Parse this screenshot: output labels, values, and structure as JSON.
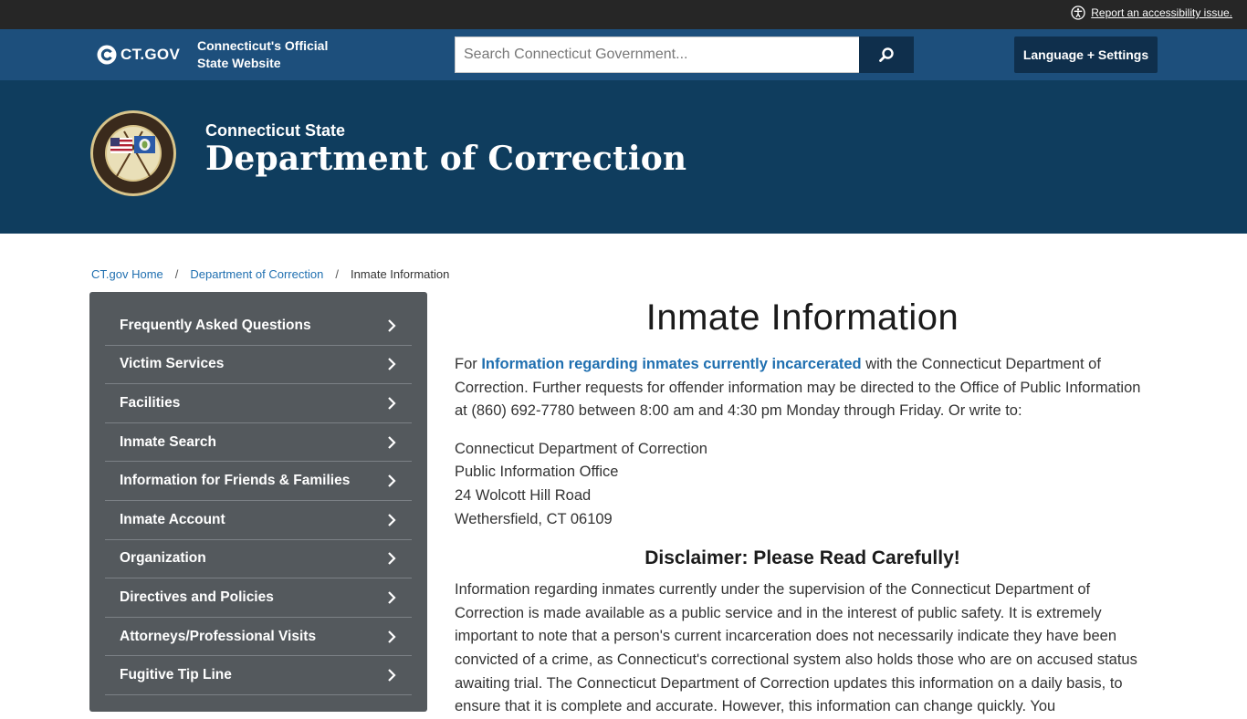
{
  "utility_bar": {
    "accessibility_link": "Report an accessibility issue."
  },
  "header": {
    "logo_text": "CT.GOV",
    "tagline": "Connecticut's Official State Website",
    "search_placeholder": "Search Connecticut Government...",
    "language_button": "Language + Settings"
  },
  "banner": {
    "subtitle": "Connecticut State",
    "title": "Department of Correction"
  },
  "breadcrumb": {
    "items": [
      "CT.gov Home",
      "Department of Correction",
      "Inmate Information"
    ]
  },
  "sidebar": {
    "items": [
      {
        "label": "Frequently Asked Questions"
      },
      {
        "label": "Victim Services"
      },
      {
        "label": "Facilities"
      },
      {
        "label": "Inmate Search"
      },
      {
        "label": "Information for Friends & Families"
      },
      {
        "label": "Inmate Account"
      },
      {
        "label": "Organization"
      },
      {
        "label": "Directives and Policies"
      },
      {
        "label": "Attorneys/Professional Visits"
      },
      {
        "label": "Fugitive Tip Line"
      }
    ]
  },
  "main": {
    "title": "Inmate Information",
    "intro_prefix": "For ",
    "intro_link": "Information regarding inmates currently incarcerated",
    "intro_suffix": " with the Connecticut Department of Correction. Further requests for offender information may be directed to the Office of Public Information at (860) 692-7780 between 8:00 am and 4:30 pm Monday through Friday.  Or write to:",
    "address": [
      "Connecticut Department of Correction",
      "Public Information Office",
      "24 Wolcott Hill Road",
      "Wethersfield, CT 06109"
    ],
    "disclaimer_title": "Disclaimer: Please Read Carefully!",
    "disclaimer_text": "Information regarding inmates currently under the supervision of the Connecticut Department of Correction is made available as a public service and in the interest of public safety. It is extremely important to note that a person's current incarceration does not necessarily indicate they have been convicted of a crime, as Connecticut's correctional system also holds those who are on accused status awaiting trial. The Connecticut Department of Correction updates this information on a daily basis, to ensure that it is complete and accurate. However, this information can change quickly. You"
  },
  "icons": {
    "accessibility": "accessibility-icon",
    "search": "search-icon",
    "chevron": "chevron-right-icon",
    "logo": "ct-logo-icon",
    "seal": "doc-seal-icon"
  },
  "colors": {
    "utility_bar": "#262626",
    "header": "#1d4f7c",
    "banner": "#0f3d5e",
    "button_dark": "#0f2f4c",
    "sidebar": "#54595d",
    "link": "#1f6fb0"
  }
}
